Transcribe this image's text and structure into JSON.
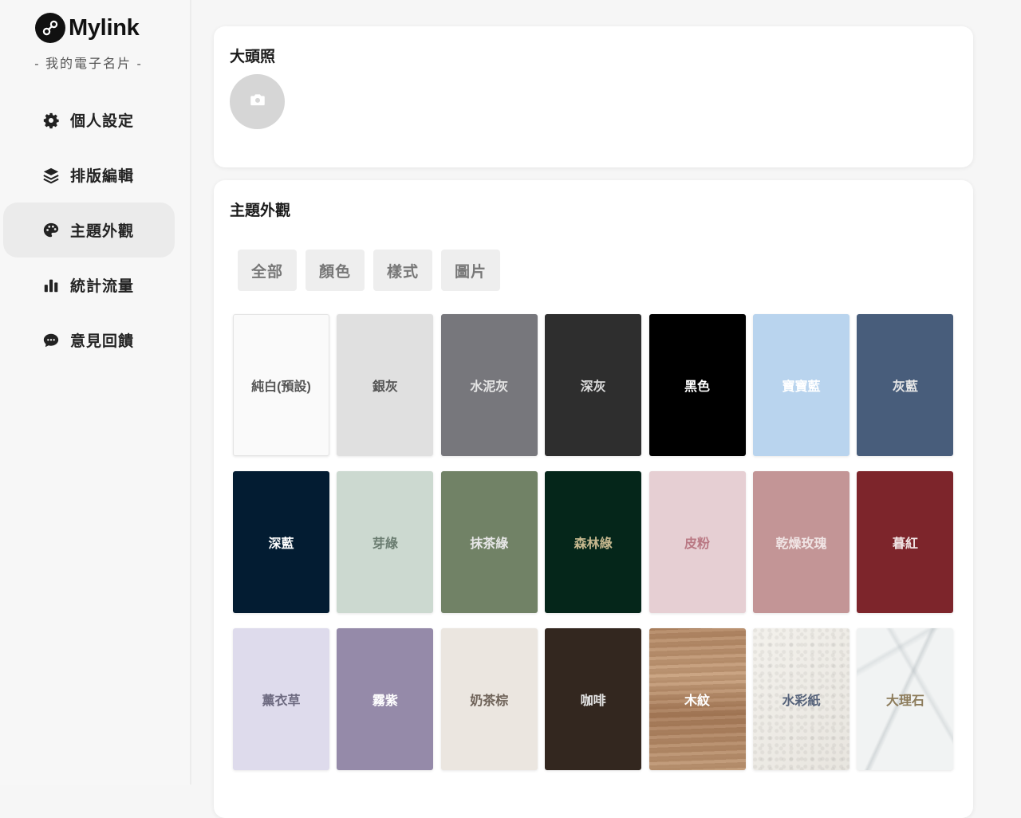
{
  "brand": {
    "name": "Mylink",
    "tagline": "- 我的電子名片 -"
  },
  "nav": [
    {
      "label": "個人設定",
      "icon": "gear-icon",
      "active": false
    },
    {
      "label": "排版編輯",
      "icon": "layers-icon",
      "active": false
    },
    {
      "label": "主題外觀",
      "icon": "palette-icon",
      "active": true
    },
    {
      "label": "統計流量",
      "icon": "bar-chart-icon",
      "active": false
    },
    {
      "label": "意見回饋",
      "icon": "chat-bubble-icon",
      "active": false
    }
  ],
  "avatar_section": {
    "title": "大頭照",
    "icon": "camera-icon"
  },
  "theme_section": {
    "title": "主題外觀",
    "filters": [
      "全部",
      "顏色",
      "樣式",
      "圖片"
    ],
    "themes": [
      {
        "name": "純白(預設)",
        "bg": "#fafafa",
        "fg": "#555555"
      },
      {
        "name": "銀灰",
        "bg": "#e0e0e0",
        "fg": "#555555"
      },
      {
        "name": "水泥灰",
        "bg": "#77777c",
        "fg": "#e6e6e6"
      },
      {
        "name": "深灰",
        "bg": "#2e2e2e",
        "fg": "#dddddd"
      },
      {
        "name": "黑色",
        "bg": "#000000",
        "fg": "#ffffff"
      },
      {
        "name": "寶寶藍",
        "bg": "#b9d4ee",
        "fg": "#ffffff"
      },
      {
        "name": "灰藍",
        "bg": "#485d7b",
        "fg": "#e6e6e6"
      },
      {
        "name": "深藍",
        "bg": "#031c32",
        "fg": "#ffffff"
      },
      {
        "name": "芽綠",
        "bg": "#ccd9d0",
        "fg": "#6b7d71"
      },
      {
        "name": "抹茶綠",
        "bg": "#718266",
        "fg": "#e6e6e6"
      },
      {
        "name": "森林綠",
        "bg": "#05261a",
        "fg": "#c7b98f"
      },
      {
        "name": "皮粉",
        "bg": "#e6cfd3",
        "fg": "#b97883"
      },
      {
        "name": "乾燥玫瑰",
        "bg": "#c39596",
        "fg": "#f0e4e4"
      },
      {
        "name": "暮紅",
        "bg": "#7d252b",
        "fg": "#f0e4e4"
      },
      {
        "name": "薰衣草",
        "bg": "#dedbec",
        "fg": "#6d6a80"
      },
      {
        "name": "霧紫",
        "bg": "#958aa9",
        "fg": "#ffffff"
      },
      {
        "name": "奶茶棕",
        "bg": "#ebe6e0",
        "fg": "#6e6258"
      },
      {
        "name": "咖啡",
        "bg": "#33271f",
        "fg": "#e6e6e6"
      },
      {
        "name": "木紋",
        "bg": "#b58a67",
        "fg": "#ffffff",
        "texture": "wood"
      },
      {
        "name": "水彩紙",
        "bg": "#efede8",
        "fg": "#55627a",
        "texture": "paper"
      },
      {
        "name": "大理石",
        "bg": "#f1f3f3",
        "fg": "#8c7b5a",
        "texture": "marble"
      }
    ]
  }
}
